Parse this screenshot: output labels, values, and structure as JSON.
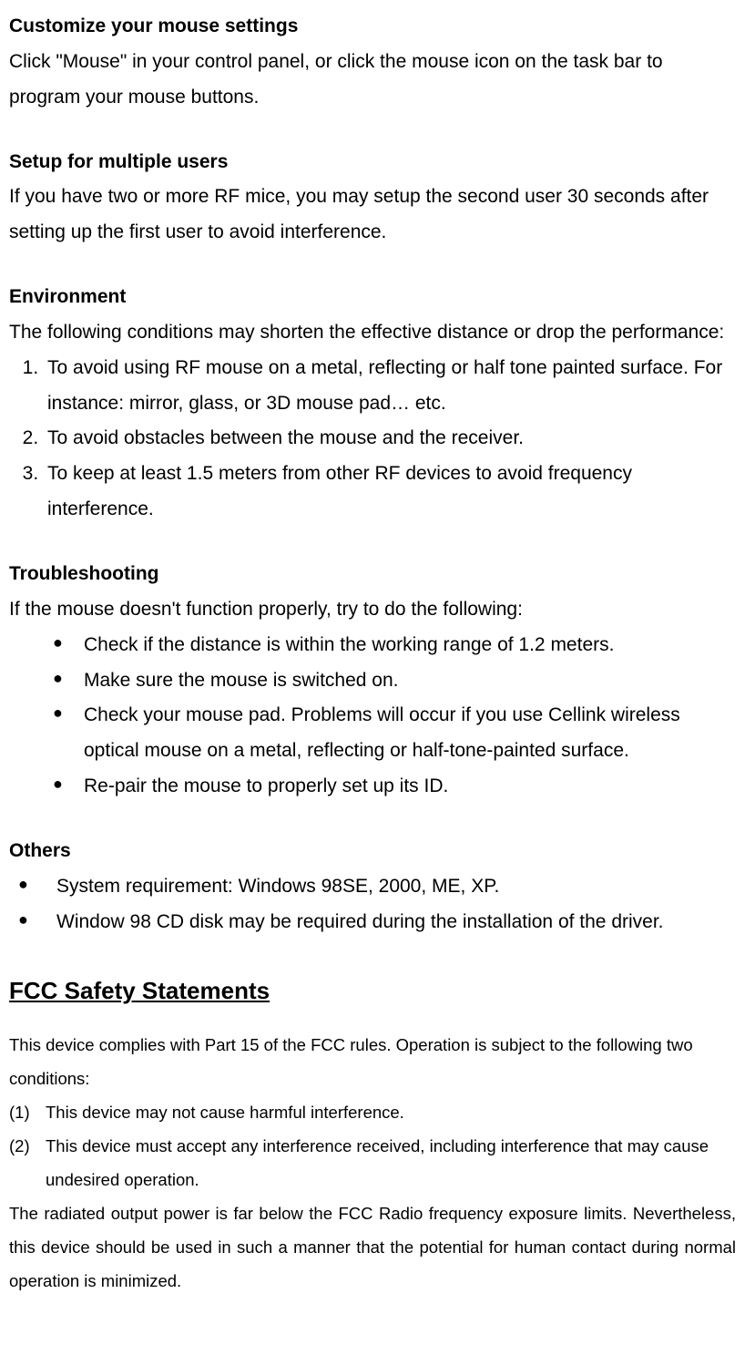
{
  "sections": {
    "customize": {
      "heading": "Customize your mouse settings",
      "body": "Click \"Mouse\" in your control panel, or click the mouse icon on the task bar to program your mouse buttons."
    },
    "multiuser": {
      "heading": "Setup for multiple users",
      "body": "If you have two or more RF mice, you may setup the second user 30 seconds after setting up the first user to avoid interference."
    },
    "environment": {
      "heading": "Environment",
      "body": "The following conditions may shorten the effective distance or drop the performance:",
      "items": [
        "To avoid using RF mouse on a metal, reflecting or half tone painted surface. For instance: mirror, glass, or 3D mouse pad… etc.",
        "To avoid obstacles between the mouse and the receiver.",
        "To keep at least 1.5 meters from other RF devices to avoid frequency interference."
      ]
    },
    "troubleshooting": {
      "heading": "Troubleshooting",
      "body": "If the mouse doesn't function properly, try to do the following:",
      "items": [
        "Check if the distance is within the working range of 1.2 meters.",
        "Make sure the mouse is switched on.",
        "Check your mouse pad. Problems will occur if you use Cellink wireless optical mouse on a metal, reflecting or half-tone-painted surface.",
        "Re-pair the mouse to properly set up its ID."
      ]
    },
    "others": {
      "heading": "Others",
      "items": [
        "System requirement: Windows 98SE, 2000, ME, XP.",
        "Window 98 CD disk may be required during the installation of the driver."
      ]
    },
    "fcc": {
      "heading": "FCC Safety Statements",
      "intro": "This device complies with Part 15 of the FCC rules. Operation is subject to the following two conditions:",
      "items": [
        {
          "num": "(1)",
          "text": "This device may not cause harmful interference."
        },
        {
          "num": "(2)",
          "text": "This device must accept any interference received, including interference that may cause undesired operation."
        }
      ],
      "footer": "The radiated output power is far below the FCC Radio frequency exposure limits. Nevertheless, this device should be used in such a manner that the potential for human contact during normal operation is minimized."
    }
  }
}
